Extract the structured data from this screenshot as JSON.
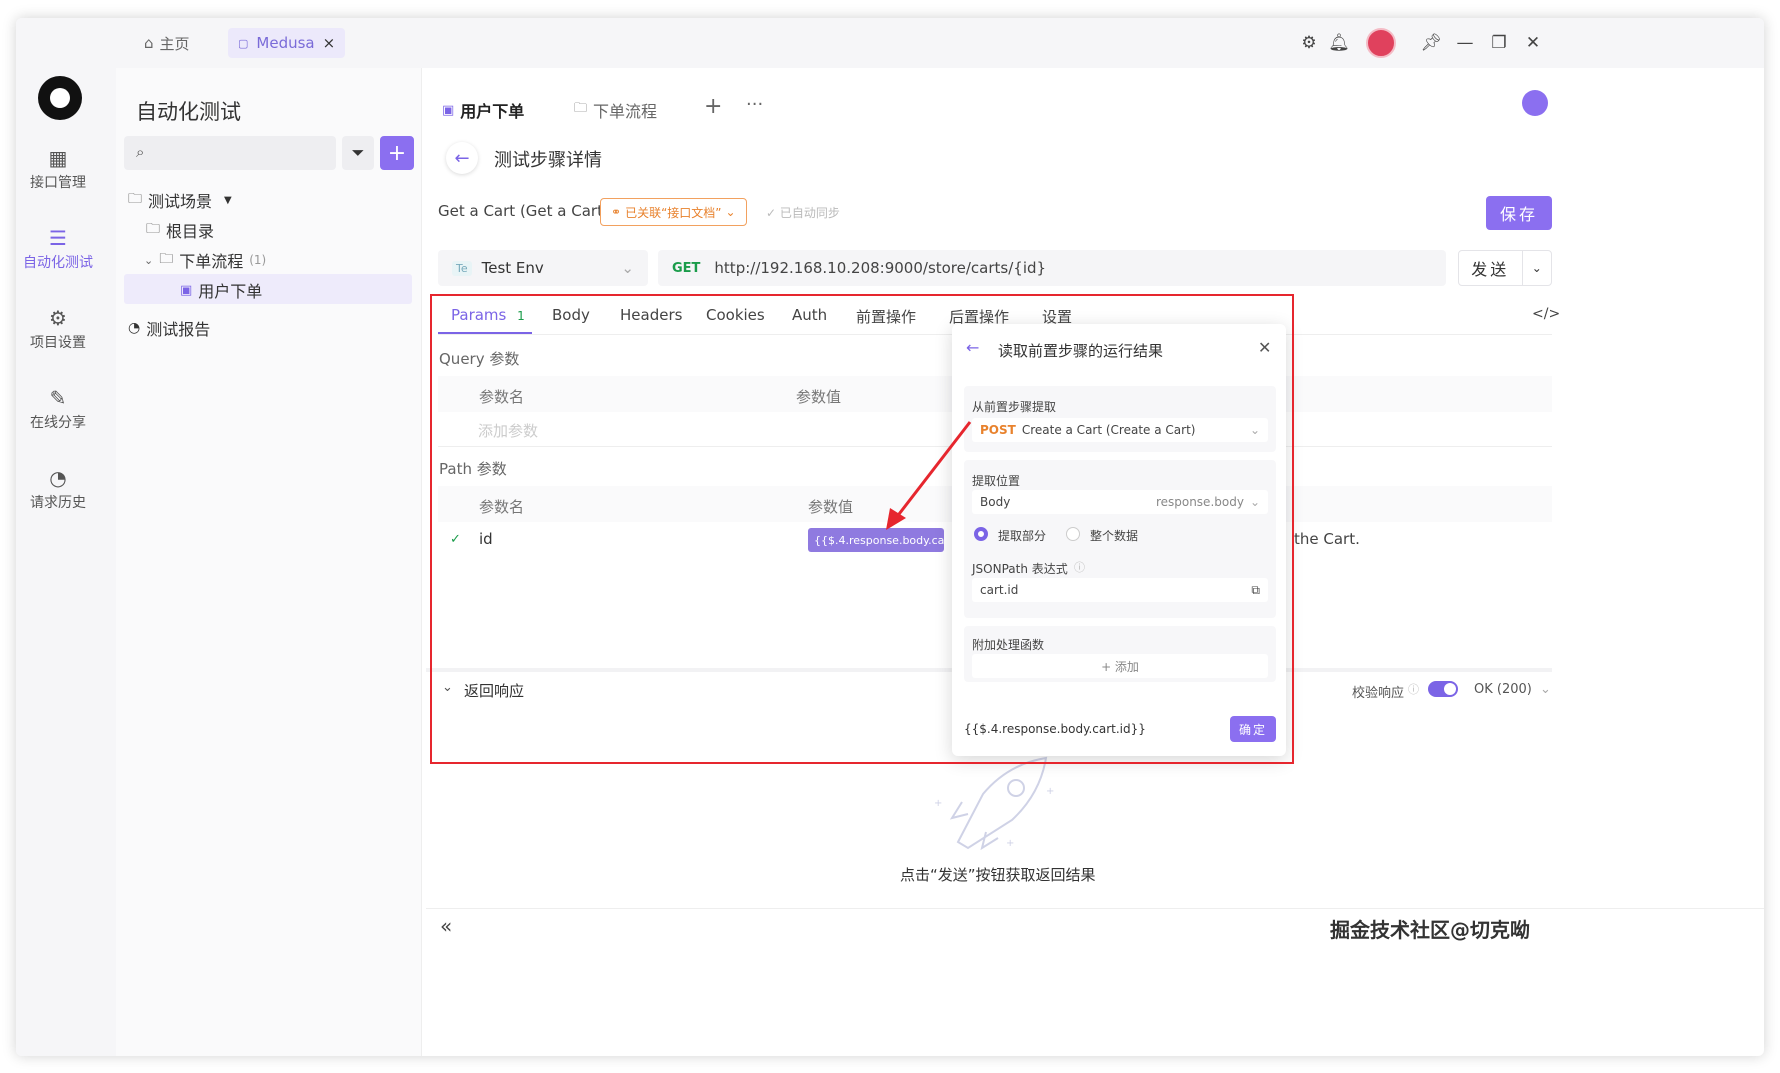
{
  "titlebar": {
    "home_label": "主页",
    "project_tab": "Medusa",
    "project_tab_close": "×"
  },
  "rail": {
    "items": [
      {
        "label": "接口管理",
        "icon": "api-icon"
      },
      {
        "label": "自动化测试",
        "icon": "automation-icon",
        "active": true
      },
      {
        "label": "项目设置",
        "icon": "project-settings-icon"
      },
      {
        "label": "在线分享",
        "icon": "share-icon"
      },
      {
        "label": "请求历史",
        "icon": "history-icon"
      }
    ]
  },
  "sidebar": {
    "title": "自动化测试",
    "tree": {
      "scenarios": "测试场景",
      "root": "根目录",
      "flow": "下单流程",
      "flow_count": "(1)",
      "case": "用户下单",
      "reports": "测试报告"
    }
  },
  "main": {
    "tabs": [
      {
        "label": "用户下单",
        "active": true
      },
      {
        "label": "下单流程",
        "active": false
      }
    ],
    "add_tab": "+",
    "more_tabs": "···",
    "page_title": "测试步骤详情",
    "api_name": "Get a Cart (Get a Cart)",
    "linked_tag": "已关联“接口文档”",
    "synced": "已自动同步",
    "save": "保存",
    "env": {
      "badge": "Te",
      "name": "Test Env"
    },
    "request": {
      "method": "GET",
      "url": "http://192.168.10.208:9000/store/carts/{id}"
    },
    "send": "发送"
  },
  "request_tabs": {
    "items": [
      {
        "label": "Params",
        "count": "1",
        "active": true
      },
      {
        "label": "Body"
      },
      {
        "label": "Headers"
      },
      {
        "label": "Cookies"
      },
      {
        "label": "Auth"
      },
      {
        "label": "前置操作"
      },
      {
        "label": "后置操作"
      },
      {
        "label": "设置"
      }
    ]
  },
  "params": {
    "query_title": "Query 参数",
    "path_title": "Path 参数",
    "col_name": "参数名",
    "col_value": "参数值",
    "add_param_placeholder": "添加参数",
    "path_rows": [
      {
        "name": "id",
        "value": "{{$.4.response.body.ca...",
        "desc_tail": "the Cart."
      }
    ]
  },
  "response": {
    "title": "返回响应",
    "validate": "校验响应",
    "status": "OK (200)",
    "empty_hint": "点击“发送”按钮获取返回结果"
  },
  "popup": {
    "title": "读取前置步骤的运行结果",
    "from_label": "从前置步骤提取",
    "from_method": "POST",
    "from_value": "Create a Cart (Create a Cart)",
    "position_label": "提取位置",
    "position_value": "Body",
    "position_hint": "response.body",
    "radio_partial": "提取部分",
    "radio_whole": "整个数据",
    "jsonpath_label": "JSONPath 表达式",
    "jsonpath_value": "cart.id",
    "func_label": "附加处理函数",
    "func_add": "+ 添加",
    "result": "{{$.4.response.body.cart.id}}",
    "confirm": "确定"
  },
  "footer": {
    "collapse": "«",
    "watermark": "掘金技术社区@切克呦"
  },
  "colors": {
    "accent": "#8b6ff0",
    "annotation": "#e6262e",
    "tag_orange": "#e8822d"
  }
}
